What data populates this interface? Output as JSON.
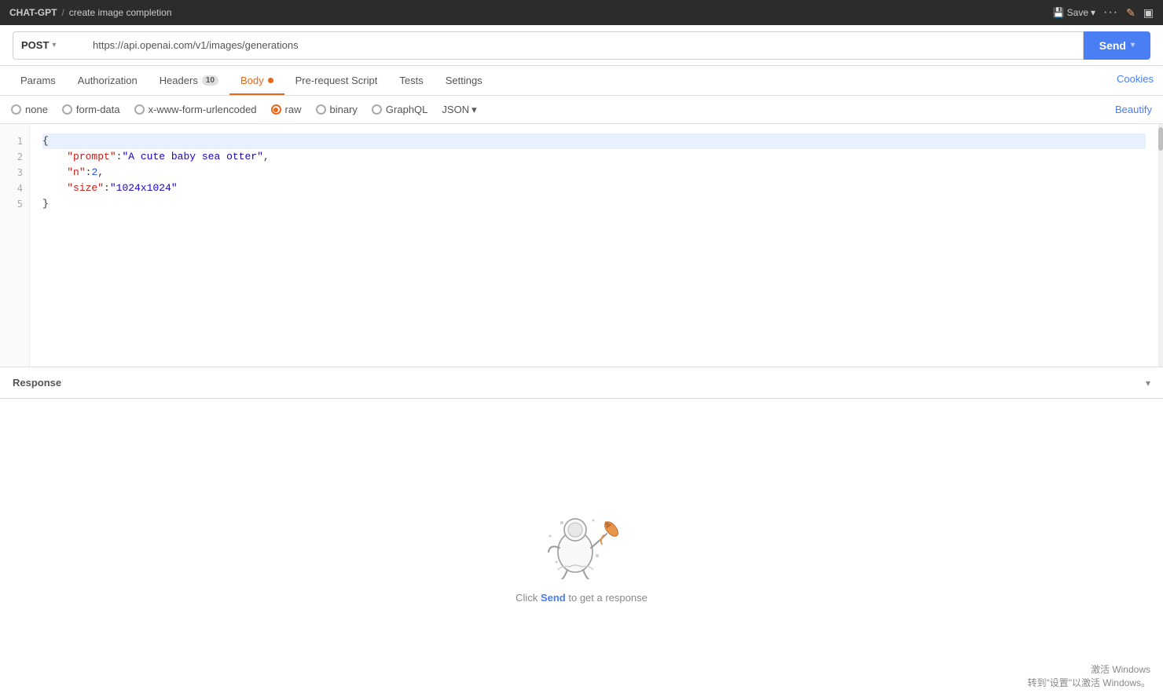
{
  "topbar": {
    "app_name": "CHAT-GPT",
    "separator": "/",
    "page_title": "create image completion",
    "save_label": "Save",
    "save_chevron": "▾",
    "dots": "···",
    "pencil": "✎",
    "layout_icon": "▣"
  },
  "urlbar": {
    "method": "POST",
    "method_chevron": "▾",
    "url": "https://api.openai.com/v1/images/generations",
    "send_label": "Send",
    "send_chevron": "▾"
  },
  "tabs": [
    {
      "id": "params",
      "label": "Params",
      "active": false,
      "badge": null,
      "dot": false
    },
    {
      "id": "authorization",
      "label": "Authorization",
      "active": false,
      "badge": null,
      "dot": false
    },
    {
      "id": "headers",
      "label": "Headers",
      "active": false,
      "badge": "10",
      "dot": false
    },
    {
      "id": "body",
      "label": "Body",
      "active": true,
      "badge": null,
      "dot": true
    },
    {
      "id": "pre-request",
      "label": "Pre-request Script",
      "active": false,
      "badge": null,
      "dot": false
    },
    {
      "id": "tests",
      "label": "Tests",
      "active": false,
      "badge": null,
      "dot": false
    },
    {
      "id": "settings",
      "label": "Settings",
      "active": false,
      "badge": null,
      "dot": false
    }
  ],
  "cookies_link": "Cookies",
  "body_options": {
    "none_label": "none",
    "form_data_label": "form-data",
    "urlencoded_label": "x-www-form-urlencoded",
    "raw_label": "raw",
    "binary_label": "binary",
    "graphql_label": "GraphQL",
    "json_label": "JSON",
    "json_chevron": "▾"
  },
  "beautify_label": "Beautify",
  "code": {
    "line1": "{",
    "line2_key": "\"prompt\"",
    "line2_sep": ": ",
    "line2_val": "\"A cute baby sea otter\"",
    "line2_comma": ",",
    "line3_key": "\"n\"",
    "line3_sep": ": ",
    "line3_val": "2",
    "line3_comma": ",",
    "line4_key": "\"size\"",
    "line4_sep": ": ",
    "line4_val": "\"1024x1024\"",
    "line5": "}"
  },
  "response": {
    "label": "Response",
    "chevron": "▾",
    "empty_text1": "Click ",
    "send_word": "Send",
    "empty_text2": " to get a response"
  },
  "windows": {
    "line1": "激活 Windows",
    "line2": "转到\"设置\"以激活 Windows。"
  }
}
